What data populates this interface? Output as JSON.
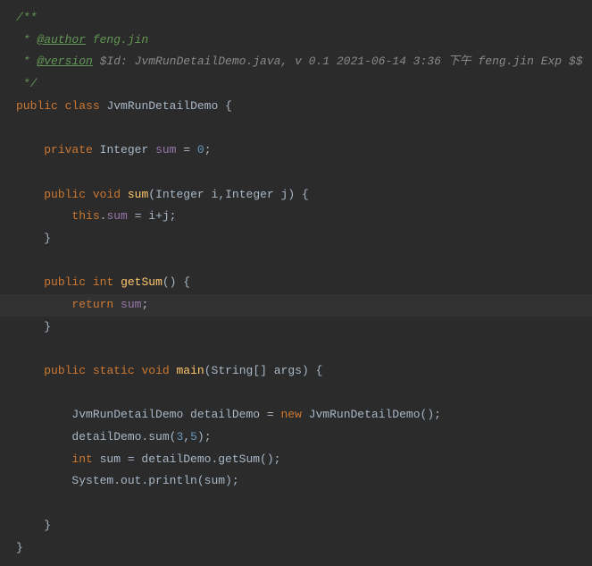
{
  "code": {
    "l1_prefix": "/**",
    "l2_star": " * ",
    "l2_tag": "@author",
    "l2_rest": " feng.jin",
    "l3_star": " * ",
    "l3_tag": "@version",
    "l3_rest": " $Id: JvmRunDetailDemo.java, v 0.1 2021-06-14 3:36 下午 feng.jin Exp $$",
    "l4_end": " */",
    "l5_kw1": "public",
    "l5_kw2": "class",
    "l5_name": "JvmRunDetailDemo",
    "l5_brace": " {",
    "l7_kw": "private",
    "l7_type": "Integer",
    "l7_field": "sum",
    "l7_eq": " = ",
    "l7_val": "0",
    "l7_semi": ";",
    "l9_kw1": "public",
    "l9_kw2": "void",
    "l9_method": "sum",
    "l9_p1": "(",
    "l9_type1": "Integer",
    "l9_arg1": " i",
    "l9_comma": ",",
    "l9_type2": "Integer",
    "l9_arg2": " j",
    "l9_p2": ") {",
    "l10_this": "this",
    "l10_dot": ".",
    "l10_field": "sum",
    "l10_eq": " = ",
    "l10_expr": "i+j",
    "l10_semi": ";",
    "l11_brace": "}",
    "l13_kw1": "public",
    "l13_kw2": "int",
    "l13_method": "getSum",
    "l13_paren": "() {",
    "l14_kw": "return",
    "l14_field": " sum",
    "l14_semi": ";",
    "l15_brace": "}",
    "l17_kw1": "public",
    "l17_kw2": "static",
    "l17_kw3": "void",
    "l17_method": "main",
    "l17_p1": "(",
    "l17_type": "String",
    "l17_arr": "[] args",
    "l17_p2": ") {",
    "l19_type": "JvmRunDetailDemo",
    "l19_var": " detailDemo",
    "l19_eq": " = ",
    "l19_new": "new",
    "l19_ctor": " JvmRunDetailDemo",
    "l19_paren": "();",
    "l20_call": "detailDemo.sum(",
    "l20_n1": "3",
    "l20_comma": ",",
    "l20_n2": "5",
    "l20_end": ");",
    "l21_kw": "int",
    "l21_rest": " sum = detailDemo.getSum();",
    "l22_sys": "System.out.println(sum);",
    "l24_brace": "}",
    "l25_brace": "}"
  }
}
